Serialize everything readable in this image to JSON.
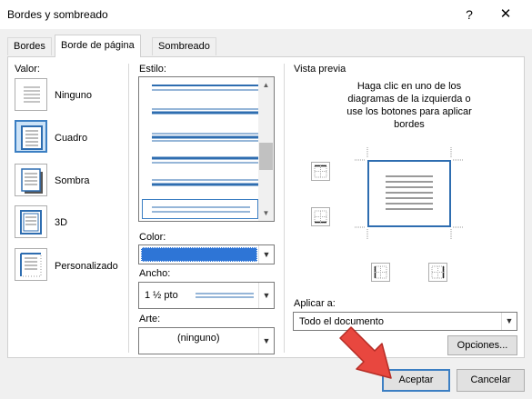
{
  "window": {
    "title": "Bordes y sombreado",
    "help_glyph": "?",
    "close_glyph": "✕"
  },
  "tabs": [
    {
      "label": "Bordes",
      "active": false
    },
    {
      "label": "Borde de página",
      "active": true
    },
    {
      "label": "Sombreado",
      "active": false
    }
  ],
  "setting": {
    "label": "Valor:",
    "options": [
      {
        "label": "Ninguno",
        "icon": "setting-none-icon",
        "selected": false
      },
      {
        "label": "Cuadro",
        "icon": "setting-box-icon",
        "selected": true
      },
      {
        "label": "Sombra",
        "icon": "setting-shadow-icon",
        "selected": false
      },
      {
        "label": "3D",
        "icon": "setting-3d-icon",
        "selected": false
      },
      {
        "label": "Personalizado",
        "icon": "setting-custom-icon",
        "selected": false
      }
    ]
  },
  "style": {
    "label": "Estilo:"
  },
  "color": {
    "label": "Color:",
    "value_swatch": "#2e75d6"
  },
  "width": {
    "label": "Ancho:",
    "value": "1 ½ pto"
  },
  "art": {
    "label": "Arte:",
    "value": "(ninguno)"
  },
  "preview": {
    "label": "Vista previa",
    "instructions": [
      "Haga clic en uno de los",
      "diagramas de la izquierda o",
      "use los botones para aplicar",
      "bordes"
    ]
  },
  "apply_to": {
    "label": "Aplicar a:",
    "value": "Todo el documento"
  },
  "buttons": {
    "options": "Opciones...",
    "ok": "Aceptar",
    "cancel": "Cancelar"
  },
  "colors": {
    "accent": "#3c7fc3",
    "line_blue": "#2e6db0",
    "pointer": "#e8473f"
  }
}
